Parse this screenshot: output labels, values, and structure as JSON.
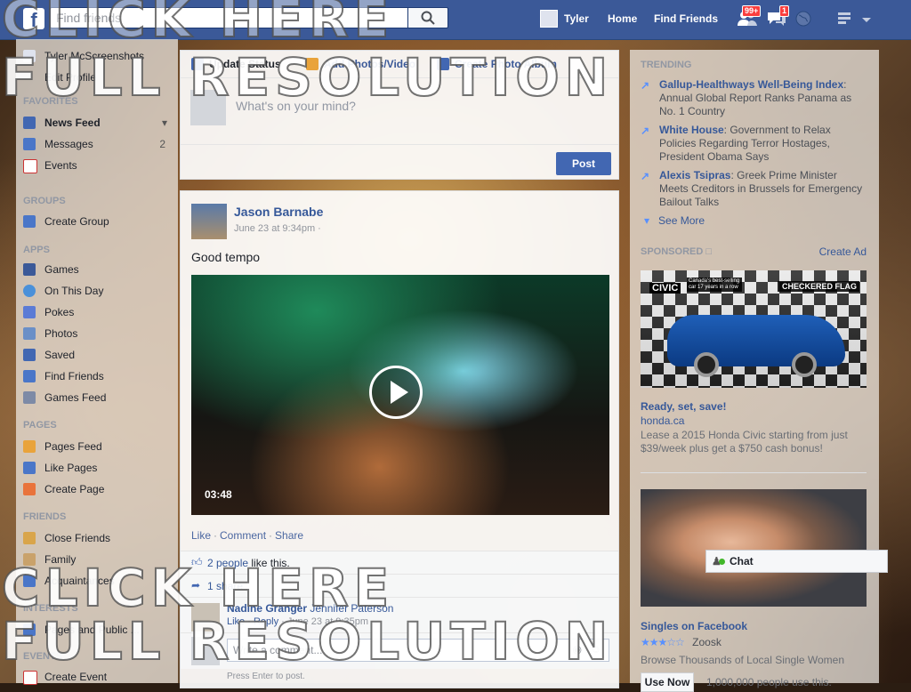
{
  "topbar": {
    "logo": "f",
    "search_placeholder": "Find friends",
    "user_name": "Tyler",
    "nav": [
      "Home",
      "Find Friends"
    ],
    "friend_requests_badge": "99+",
    "messages_badge": "1"
  },
  "left_nav": {
    "profile_name": "Tyler McScreenshots",
    "edit_profile": "Edit Profile",
    "favorites_header": "FAVORITES",
    "favorites": [
      {
        "label": "News Feed",
        "count": ""
      },
      {
        "label": "Messages",
        "count": "2"
      },
      {
        "label": "Events",
        "count": ""
      }
    ],
    "groups_header": "GROUPS",
    "groups": [
      {
        "label": "Create Group"
      }
    ],
    "apps_header": "APPS",
    "apps": [
      {
        "label": "Games"
      },
      {
        "label": "On This Day"
      },
      {
        "label": "Pokes"
      },
      {
        "label": "Photos"
      },
      {
        "label": "Saved"
      },
      {
        "label": "Find Friends"
      },
      {
        "label": "Games Feed"
      }
    ],
    "pages_header": "PAGES",
    "pages": [
      {
        "label": "Pages Feed"
      },
      {
        "label": "Like Pages"
      },
      {
        "label": "Create Page"
      }
    ],
    "friends_header": "FRIENDS",
    "friends": [
      {
        "label": "Close Friends"
      },
      {
        "label": "Family"
      },
      {
        "label": "Acquaintances"
      }
    ],
    "interests_header": "INTERESTS",
    "interests": [
      {
        "label": "Pages and Public ..."
      }
    ],
    "events_header": "EVENTS",
    "events": [
      {
        "label": "Create Event"
      }
    ]
  },
  "composer": {
    "tabs": [
      "Update Status",
      "Add Photos/Video",
      "Create Photo Album"
    ],
    "placeholder": "What's on your mind?",
    "post_button": "Post"
  },
  "post": {
    "author": "Jason Barnabe",
    "time": "June 23 at 9:34pm ·",
    "text": "Good tempo",
    "video_duration": "03:48",
    "actions": [
      "Like",
      "Comment",
      "Share"
    ],
    "likes_link": "2 people",
    "likes_suffix": " like this.",
    "shares": "1 share",
    "comment": {
      "author": "Nadine Granger",
      "text": "Jennifer Paterson",
      "like": "Like",
      "reply": "Reply",
      "time": "June 23 at 9:35pm"
    },
    "write_placeholder": "Write a comment...",
    "enter_hint": "Press Enter to post."
  },
  "right": {
    "trending_header": "TRENDING",
    "trending": [
      {
        "topic": "Gallup-Healthways Well-Being Index",
        "desc": ": Annual Global Report Ranks Panama as No. 1 Country"
      },
      {
        "topic": "White House",
        "desc": ": Government to Relax Policies Regarding Terror Hostages, President Obama Says"
      },
      {
        "topic": "Alexis Tsipras",
        "desc": ": Greek Prime Minister Meets Creditors in Brussels for Emergency Bailout Talks"
      }
    ],
    "see_more": "See More",
    "sponsored_header": "SPONSORED",
    "create_ad": "Create Ad",
    "ad1": {
      "image_brand": "CIVIC",
      "image_tag": "Canada's best-selling car 17 years in a row",
      "image_event": "CHECKERED FLAG",
      "title": "Ready, set, save!",
      "domain": "honda.ca",
      "text": "Lease a 2015 Honda Civic starting from just $39/week plus get a $750 cash bonus!"
    },
    "ad2": {
      "title": "Singles on Facebook",
      "brand": "Zoosk",
      "text": "Browse Thousands of Local Single Women",
      "button": "Use Now",
      "social": "1,000,000 people use this."
    },
    "rating_stars": 3
  },
  "chat": {
    "label": "Chat"
  },
  "watermark": {
    "line1": "CLICK HERE",
    "line2": "FULL RESOLUTION"
  },
  "colors": {
    "brand": "#3b5998",
    "link": "#365899",
    "badge": "#fa3e3e"
  }
}
